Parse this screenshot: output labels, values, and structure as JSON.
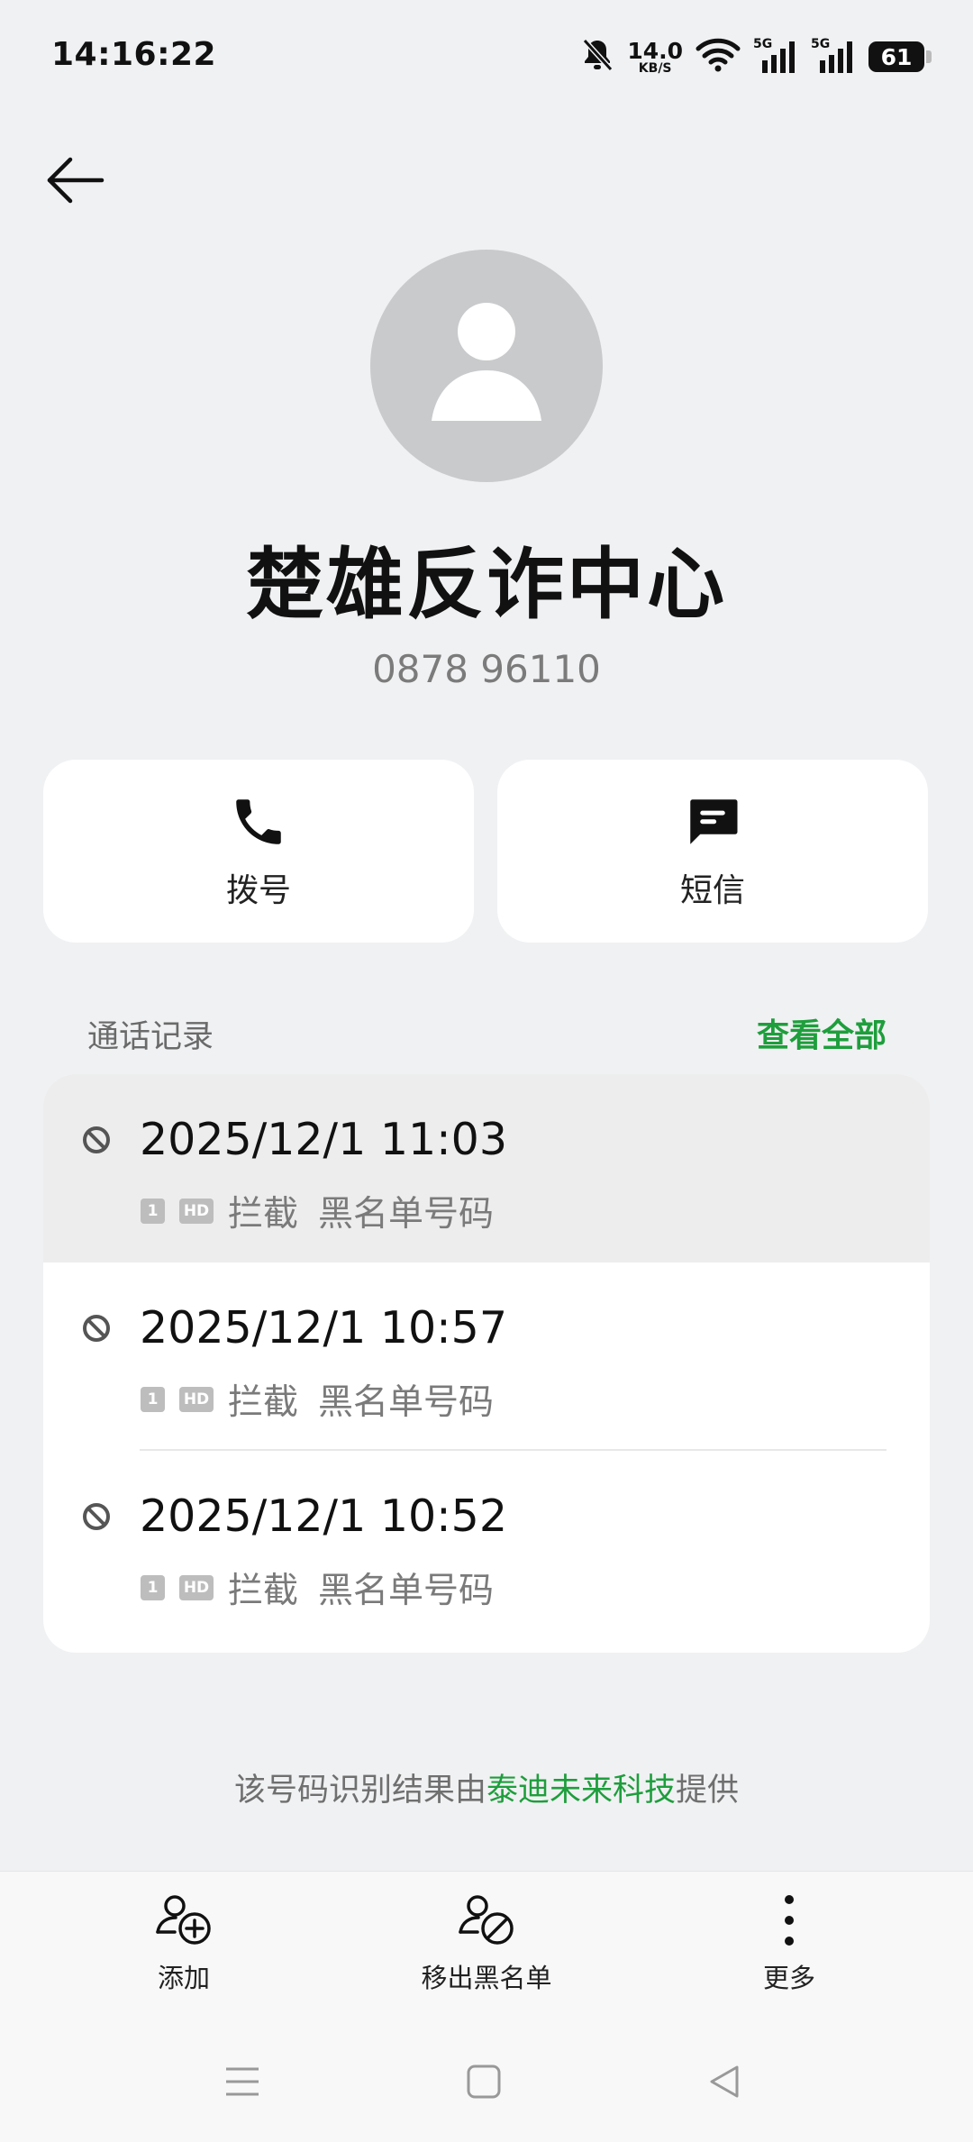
{
  "status_bar": {
    "time": "14:16:22",
    "net_speed_value": "14.0",
    "net_speed_unit": "KB/S",
    "signal_1_label": "5G",
    "signal_2_label": "5G",
    "battery": "61"
  },
  "contact": {
    "name": "楚雄反诈中心",
    "number": "0878 96110"
  },
  "actions": {
    "dial_label": "拨号",
    "sms_label": "短信"
  },
  "call_log": {
    "title": "通话记录",
    "see_all": "查看全部",
    "records": [
      {
        "time": "2025/12/1 11:03",
        "sim": "1",
        "hd": "HD",
        "status": "拦截",
        "reason": "黑名单号码"
      },
      {
        "time": "2025/12/1 10:57",
        "sim": "1",
        "hd": "HD",
        "status": "拦截",
        "reason": "黑名单号码"
      },
      {
        "time": "2025/12/1 10:52",
        "sim": "1",
        "hd": "HD",
        "status": "拦截",
        "reason": "黑名单号码"
      }
    ]
  },
  "provider": {
    "prefix": "该号码识别结果由",
    "brand": "泰迪未来科技",
    "suffix": "提供"
  },
  "bottom_actions": {
    "add_label": "添加",
    "unblock_label": "移出黑名单",
    "more_label": "更多"
  },
  "colors": {
    "accent_green": "#1E9E3C",
    "background": "#F0F1F3",
    "avatar_bg": "#C9CACC"
  }
}
